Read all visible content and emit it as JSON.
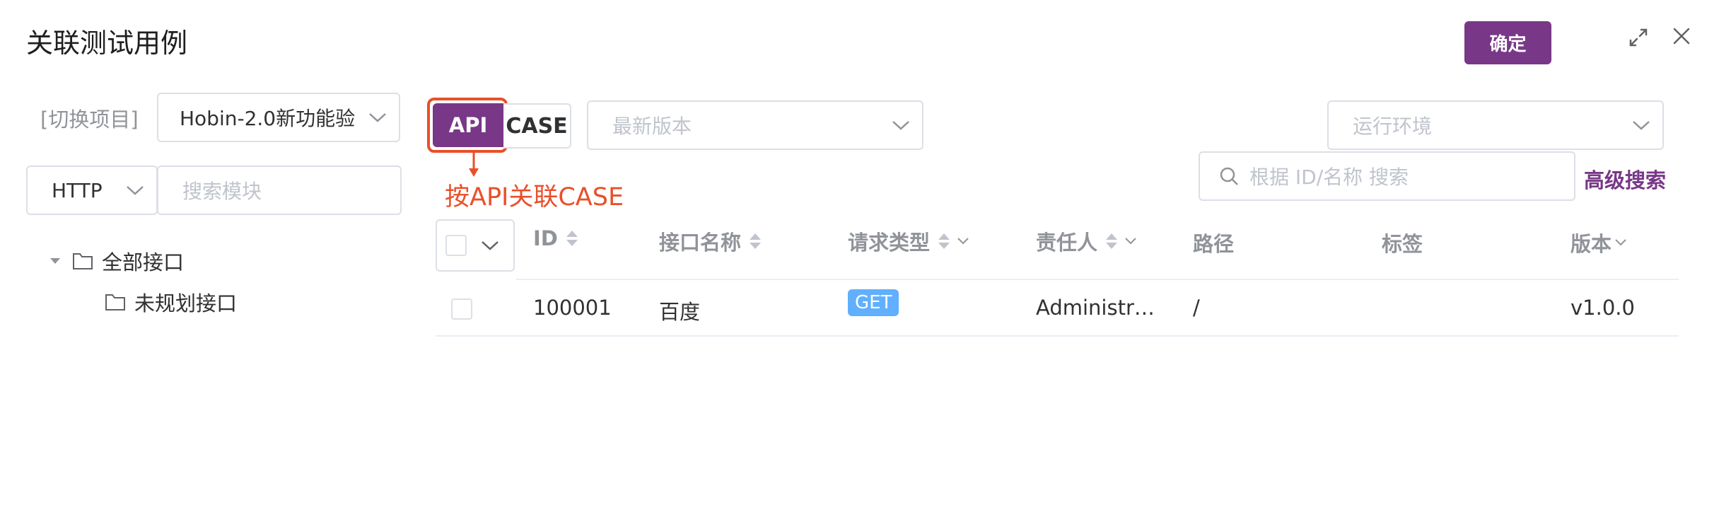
{
  "dialog": {
    "title": "关联测试用例",
    "confirm_label": "确定"
  },
  "icons": {
    "maximize": "expand-icon",
    "close": "close-icon"
  },
  "sidebar": {
    "project_label": "[切换项目]",
    "project_value": "Hobin-2.0新功能验",
    "protocol_value": "HTTP",
    "module_search_placeholder": "搜索模块",
    "tree": [
      {
        "label": "全部接口"
      },
      {
        "label": "未规划接口"
      }
    ]
  },
  "toolbar": {
    "api_label": "API",
    "case_label": "CASE",
    "version_placeholder": "最新版本",
    "env_placeholder": "运行环境",
    "search_placeholder": "根据 ID/名称 搜索",
    "advanced_search_label": "高级搜索",
    "annotation": "按API关联CASE"
  },
  "table": {
    "columns": [
      "ID",
      "接口名称",
      "请求类型",
      "责任人",
      "路径",
      "标签",
      "版本"
    ],
    "rows": [
      {
        "id": "100001",
        "name": "百度",
        "method": "GET",
        "owner": "Administr…",
        "path": "/",
        "tags": "",
        "version": "v1.0.0"
      }
    ]
  },
  "colors": {
    "primary": "#783887",
    "annotation": "#e9502a",
    "get_badge": "#61affe"
  }
}
